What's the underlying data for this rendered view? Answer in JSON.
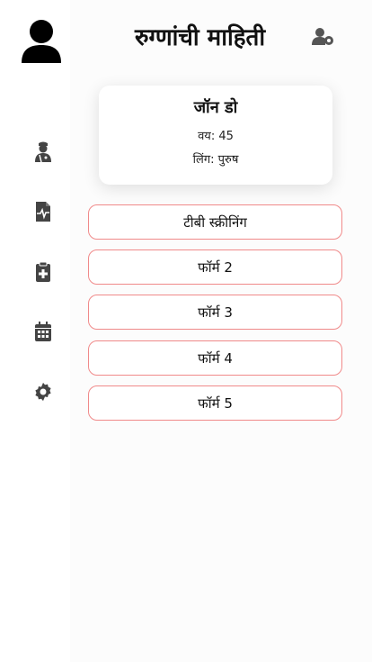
{
  "header": {
    "title": "रुग्णांची माहिती"
  },
  "patient": {
    "name": "जॉन डो",
    "age_label": "वय",
    "age": "45",
    "gender_label": "लिंग",
    "gender": "पुरुष"
  },
  "forms": [
    {
      "label": "टीबी स्क्रीनिंग"
    },
    {
      "label": "फॉर्म 2"
    },
    {
      "label": "फॉर्म 3"
    },
    {
      "label": "फॉर्म 4"
    },
    {
      "label": "फॉर्म 5"
    }
  ],
  "sidebar": {
    "icons": [
      "doctor-icon",
      "medical-report-icon",
      "clipboard-medical-icon",
      "calendar-icon",
      "gear-icon"
    ]
  },
  "colors": {
    "button_border": "#f08a8a",
    "icon": "#444444",
    "text": "#111111"
  }
}
